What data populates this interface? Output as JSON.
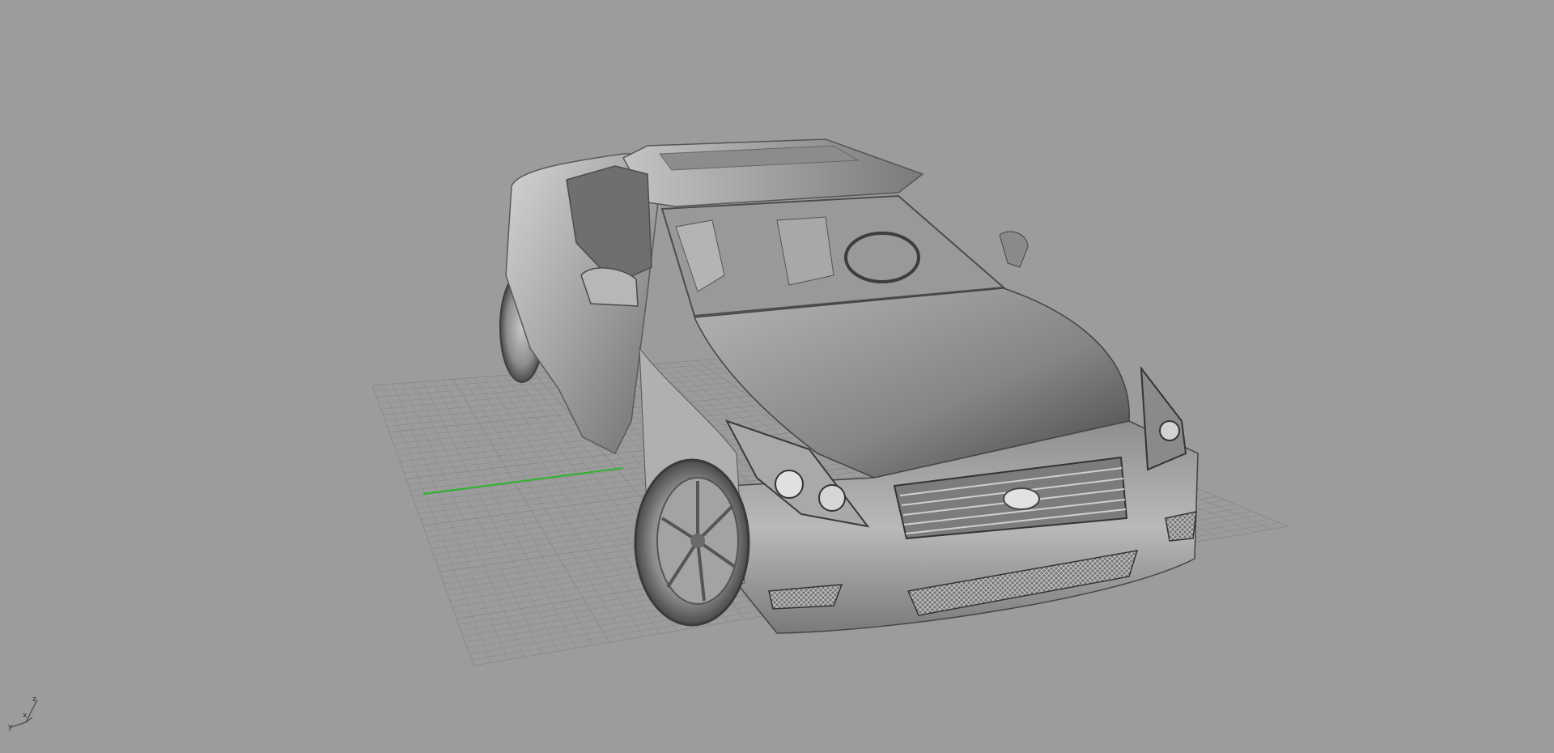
{
  "viewport": {
    "background_color": "#9c9c9c",
    "grid_color": "#8a8a8a",
    "grid_x_axis_color": "#8a8a8a",
    "grid_y_axis_color": "#2db52d",
    "render_mode": "shaded",
    "model_name_icon": "car-model-icon"
  },
  "axis_widget": {
    "z_label": "z",
    "x_label": "x",
    "y_label": "y"
  }
}
